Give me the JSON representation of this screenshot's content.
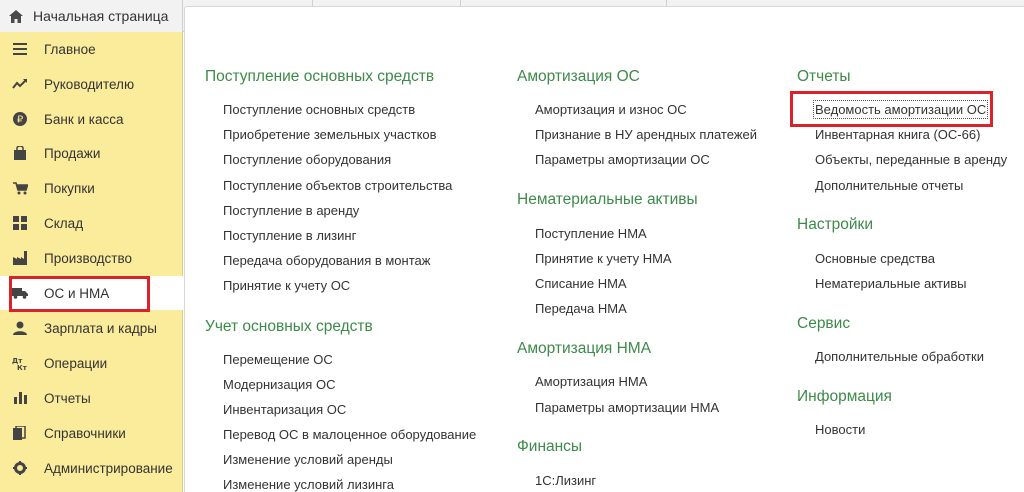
{
  "top": {
    "home_tab": "Начальная страница"
  },
  "sidebar": {
    "items": [
      {
        "label": "Главное",
        "icon": "hamburger-icon"
      },
      {
        "label": "Руководителю",
        "icon": "trend-icon"
      },
      {
        "label": "Банк и касса",
        "icon": "ruble-coin-icon"
      },
      {
        "label": "Продажи",
        "icon": "shopping-bag-icon"
      },
      {
        "label": "Покупки",
        "icon": "cart-icon"
      },
      {
        "label": "Склад",
        "icon": "warehouse-grid-icon"
      },
      {
        "label": "Производство",
        "icon": "factory-icon"
      },
      {
        "label": "ОС и НМА",
        "icon": "truck-icon"
      },
      {
        "label": "Зарплата и кадры",
        "icon": "person-icon"
      },
      {
        "label": "Операции",
        "icon": "dt-kt-icon"
      },
      {
        "label": "Отчеты",
        "icon": "bar-chart-icon"
      },
      {
        "label": "Справочники",
        "icon": "books-icon"
      },
      {
        "label": "Администрирование",
        "icon": "gear-icon"
      }
    ],
    "active_index": 7
  },
  "main": {
    "col1": {
      "group1": {
        "title": "Поступление основных средств",
        "links": [
          "Поступление основных средств",
          "Приобретение земельных участков",
          "Поступление оборудования",
          "Поступление объектов строительства",
          "Поступление в аренду",
          "Поступление в лизинг",
          "Передача оборудования в монтаж",
          "Принятие к учету ОС"
        ]
      },
      "group2": {
        "title": "Учет основных средств",
        "links": [
          "Перемещение ОС",
          "Модернизация ОС",
          "Инвентаризация ОС",
          "Перевод ОС в малоценное оборудование",
          "Изменение условий аренды",
          "Изменение условий лизинга"
        ]
      }
    },
    "col2": {
      "group1": {
        "title": "Амортизация ОС",
        "links": [
          "Амортизация и износ ОС",
          "Признание в НУ арендных платежей",
          "Параметры амортизации ОС"
        ]
      },
      "group2": {
        "title": "Нематериальные активы",
        "links": [
          "Поступление НМА",
          "Принятие к учету НМА",
          "Списание НМА",
          "Передача НМА"
        ]
      },
      "group3": {
        "title": "Амортизация НМА",
        "links": [
          "Амортизация НМА",
          "Параметры амортизации НМА"
        ]
      },
      "group4": {
        "title": "Финансы",
        "links": [
          "1С:Лизинг"
        ]
      }
    },
    "col3": {
      "group1": {
        "title": "Отчеты",
        "links": [
          "Ведомость амортизации ОС",
          "Инвентарная книга (ОС-66)",
          "Объекты, переданные в аренду",
          "Дополнительные отчеты"
        ]
      },
      "group2": {
        "title": "Настройки",
        "links": [
          "Основные средства",
          "Нематериальные активы"
        ]
      },
      "group3": {
        "title": "Сервис",
        "links": [
          "Дополнительные обработки"
        ]
      },
      "group4": {
        "title": "Информация",
        "links": [
          "Новости"
        ]
      }
    }
  },
  "colors": {
    "sidebar_bg": "#fbec9c",
    "group_title": "#3d8a49",
    "highlight": "#d9222a"
  }
}
